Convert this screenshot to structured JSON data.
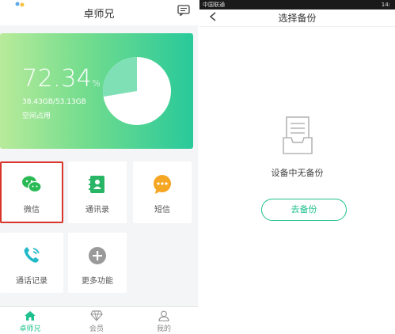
{
  "left": {
    "header": {
      "title": "卓师兄"
    },
    "storage": {
      "percent": "72.34",
      "percent_unit": "%",
      "size": "38.43GB/53.13GB",
      "label": "空间占用",
      "used_fraction": 0.7234
    },
    "tiles": [
      {
        "label": "微信",
        "icon": "wechat-icon"
      },
      {
        "label": "通讯录",
        "icon": "contacts-icon"
      },
      {
        "label": "短信",
        "icon": "sms-icon"
      },
      {
        "label": "通话记录",
        "icon": "call-log-icon"
      },
      {
        "label": "更多功能",
        "icon": "plus-icon"
      }
    ],
    "nav": [
      {
        "label": "卓师兄",
        "icon": "home-icon",
        "active": true
      },
      {
        "label": "会员",
        "icon": "diamond-icon",
        "active": false
      },
      {
        "label": "我的",
        "icon": "user-icon",
        "active": false
      }
    ]
  },
  "right": {
    "status_bar": {
      "carrier": "中国联通",
      "right": "14:"
    },
    "header": {
      "title": "选择备份"
    },
    "empty_message": "设备中无备份",
    "button_label": "去备份"
  },
  "colors": {
    "accent": "#20c08e",
    "selected_outline": "#d9352b",
    "wechat": "#2aba55",
    "contacts": "#29b566",
    "sms": "#f5a623",
    "call": "#23b8c8",
    "more": "#9a9a9a"
  }
}
